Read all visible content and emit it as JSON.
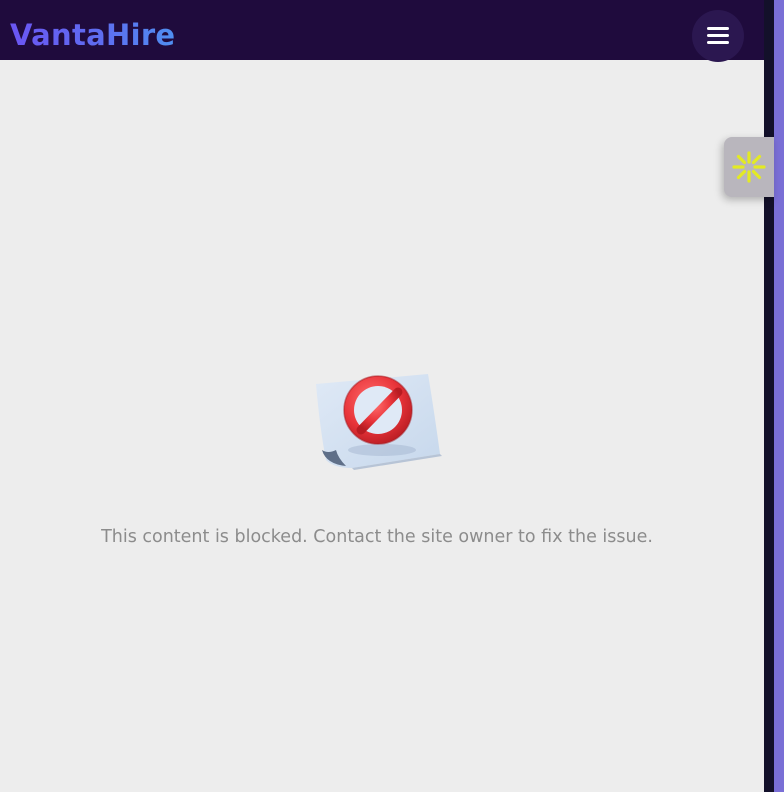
{
  "header": {
    "brand": "VantaHire",
    "menu_icon": "hamburger-menu-icon",
    "background_color": "#1f0b3d"
  },
  "side_widget": {
    "icon": "asterisk-spark-icon",
    "icon_color": "#e3ea24"
  },
  "blocked": {
    "icon": "blocked-content-icon",
    "message": "This content is blocked. Contact the site owner to fix the issue."
  },
  "colors": {
    "page_background": "#ededed",
    "brand_gradient_start": "#6b56f2",
    "brand_gradient_end": "#4f8ff0",
    "message_text": "#8c8c8c",
    "right_accent": "#7a6fd6"
  }
}
